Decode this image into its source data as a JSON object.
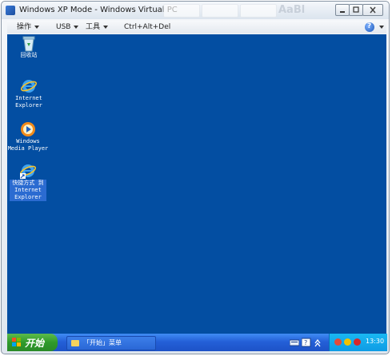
{
  "window": {
    "title": "Windows XP Mode - Windows Virtual PC",
    "ghost_text": "AaBl"
  },
  "menubar": {
    "items": [
      {
        "label": "操作",
        "has_dropdown": true
      },
      {
        "label": "USB",
        "has_dropdown": true
      },
      {
        "label": "工具",
        "has_dropdown": true
      },
      {
        "label": "Ctrl+Alt+Del",
        "has_dropdown": false
      }
    ]
  },
  "desktop": {
    "background": "#034ea2",
    "icons": [
      {
        "name": "recycle-bin",
        "label_lines": [
          "回收站"
        ],
        "icon": "recycle-bin-icon"
      },
      {
        "name": "internet-explorer",
        "label_lines": [
          "Internet",
          "Explorer"
        ],
        "icon": "internet-explorer-icon"
      },
      {
        "name": "windows-media-player",
        "label_lines": [
          "Windows",
          "Media Player"
        ],
        "icon": "media-player-icon"
      },
      {
        "name": "ie-shortcut",
        "label_lines": [
          "快捷方式 到",
          "Internet",
          "Explorer"
        ],
        "icon": "internet-explorer-shortcut-icon",
        "selected": true
      }
    ]
  },
  "taskbar": {
    "start_label": "开始",
    "task_label": "「开始」菜单",
    "clock": "13:30"
  }
}
